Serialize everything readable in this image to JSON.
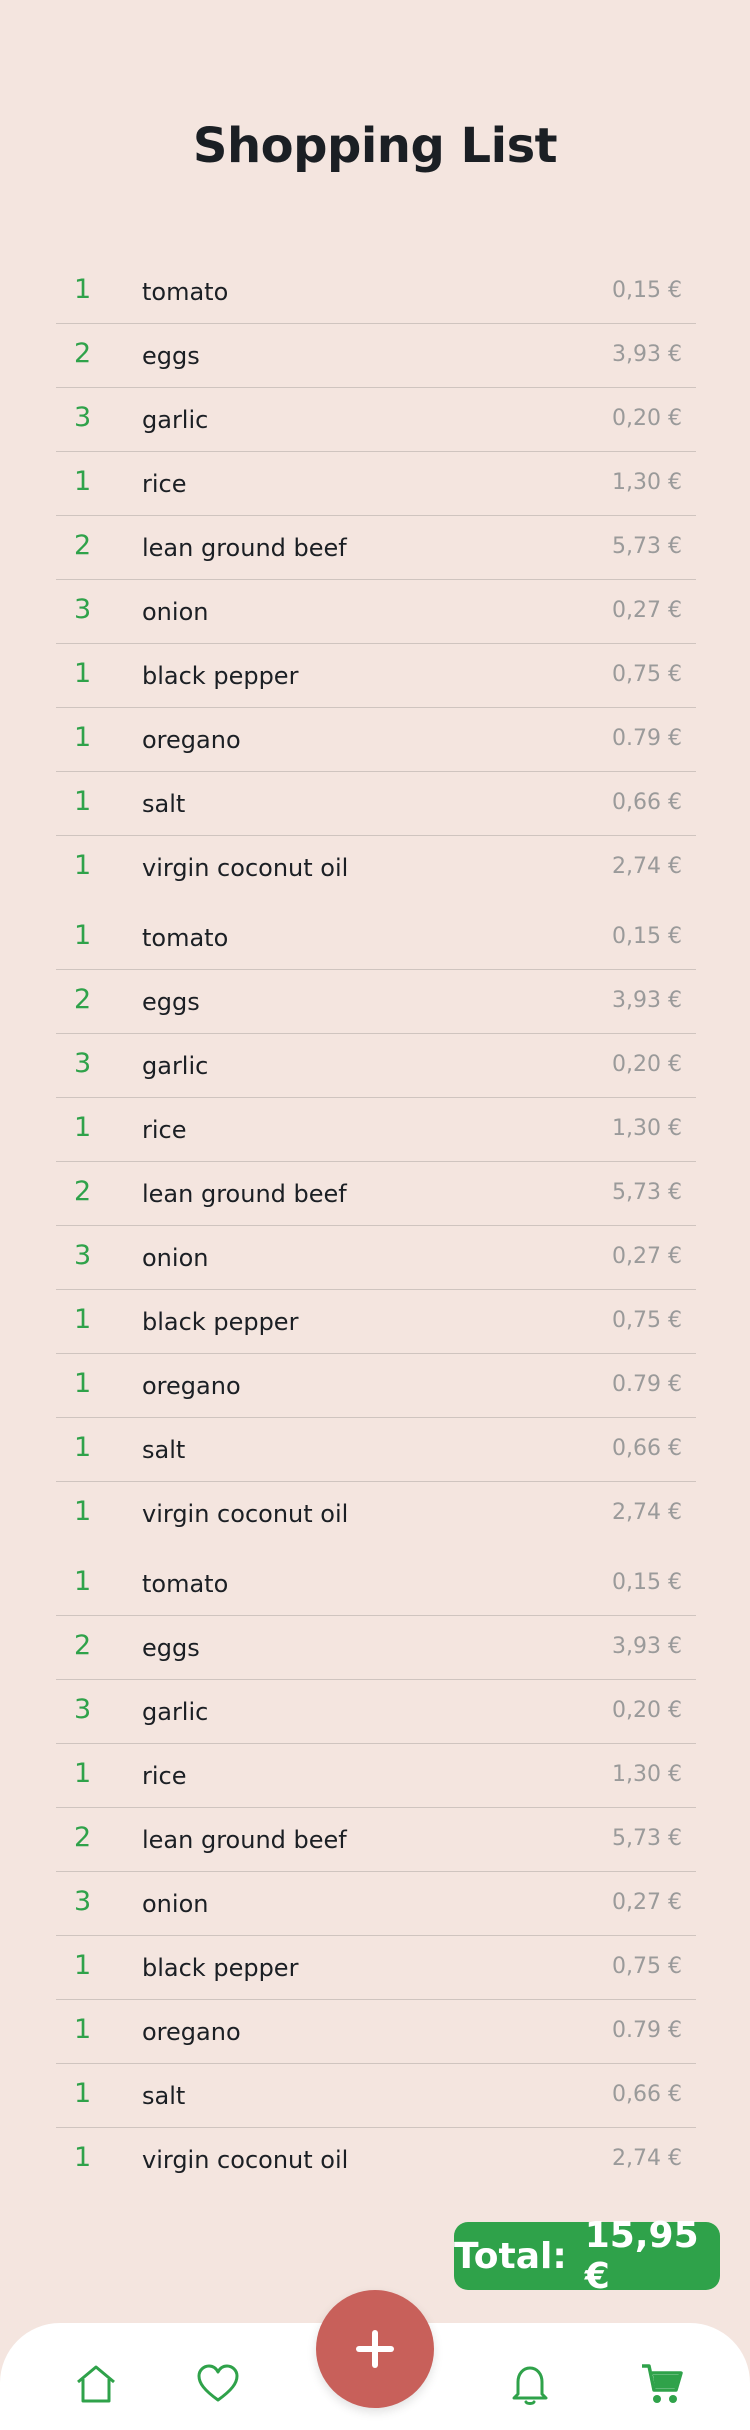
{
  "title": "Shopping List",
  "items": [
    {
      "qty": "1",
      "name": "tomato",
      "price": "0,15 €"
    },
    {
      "qty": "2",
      "name": "eggs",
      "price": "3,93 €"
    },
    {
      "qty": "3",
      "name": "garlic",
      "price": "0,20 €"
    },
    {
      "qty": "1",
      "name": "rice",
      "price": "1,30 €"
    },
    {
      "qty": "2",
      "name": "lean ground beef",
      "price": "5,73 €"
    },
    {
      "qty": "3",
      "name": "onion",
      "price": "0,27 €"
    },
    {
      "qty": "1",
      "name": "black pepper",
      "price": "0,75 €"
    },
    {
      "qty": "1",
      "name": "oregano",
      "price": "0.79 €"
    },
    {
      "qty": "1",
      "name": "salt",
      "price": "0,66 €"
    },
    {
      "qty": "1",
      "name": "virgin coconut oil",
      "price": "2,74 €"
    },
    {
      "qty": "1",
      "name": "tomato",
      "price": "0,15 €"
    },
    {
      "qty": "2",
      "name": "eggs",
      "price": "3,93 €"
    },
    {
      "qty": "3",
      "name": "garlic",
      "price": "0,20 €"
    },
    {
      "qty": "1",
      "name": "rice",
      "price": "1,30 €"
    },
    {
      "qty": "2",
      "name": "lean ground beef",
      "price": "5,73 €"
    },
    {
      "qty": "3",
      "name": "onion",
      "price": "0,27 €"
    },
    {
      "qty": "1",
      "name": "black pepper",
      "price": "0,75 €"
    },
    {
      "qty": "1",
      "name": "oregano",
      "price": "0.79 €"
    },
    {
      "qty": "1",
      "name": "salt",
      "price": "0,66 €"
    },
    {
      "qty": "1",
      "name": "virgin coconut oil",
      "price": "2,74 €"
    },
    {
      "qty": "1",
      "name": "tomato",
      "price": "0,15 €"
    },
    {
      "qty": "2",
      "name": "eggs",
      "price": "3,93 €"
    },
    {
      "qty": "3",
      "name": "garlic",
      "price": "0,20 €"
    },
    {
      "qty": "1",
      "name": "rice",
      "price": "1,30 €"
    },
    {
      "qty": "2",
      "name": "lean ground beef",
      "price": "5,73 €"
    },
    {
      "qty": "3",
      "name": "onion",
      "price": "0,27 €"
    },
    {
      "qty": "1",
      "name": "black pepper",
      "price": "0,75 €"
    },
    {
      "qty": "1",
      "name": "oregano",
      "price": "0.79 €"
    },
    {
      "qty": "1",
      "name": "salt",
      "price": "0,66 €"
    },
    {
      "qty": "1",
      "name": "virgin coconut oil",
      "price": "2,74 €"
    }
  ],
  "total": {
    "label": "Total:",
    "value": "15,95 €"
  },
  "nav": {
    "items": [
      {
        "icon": "home-icon"
      },
      {
        "icon": "heart-icon"
      },
      {
        "icon": "bell-icon"
      },
      {
        "icon": "cart-icon"
      }
    ],
    "fab_icon": "plus-icon"
  },
  "colors": {
    "background": "#f4e5df",
    "accent_green": "#2fa24a",
    "fab_red": "#c8605a",
    "text_dark": "#1b1f24",
    "text_muted": "#9a9a9a"
  }
}
